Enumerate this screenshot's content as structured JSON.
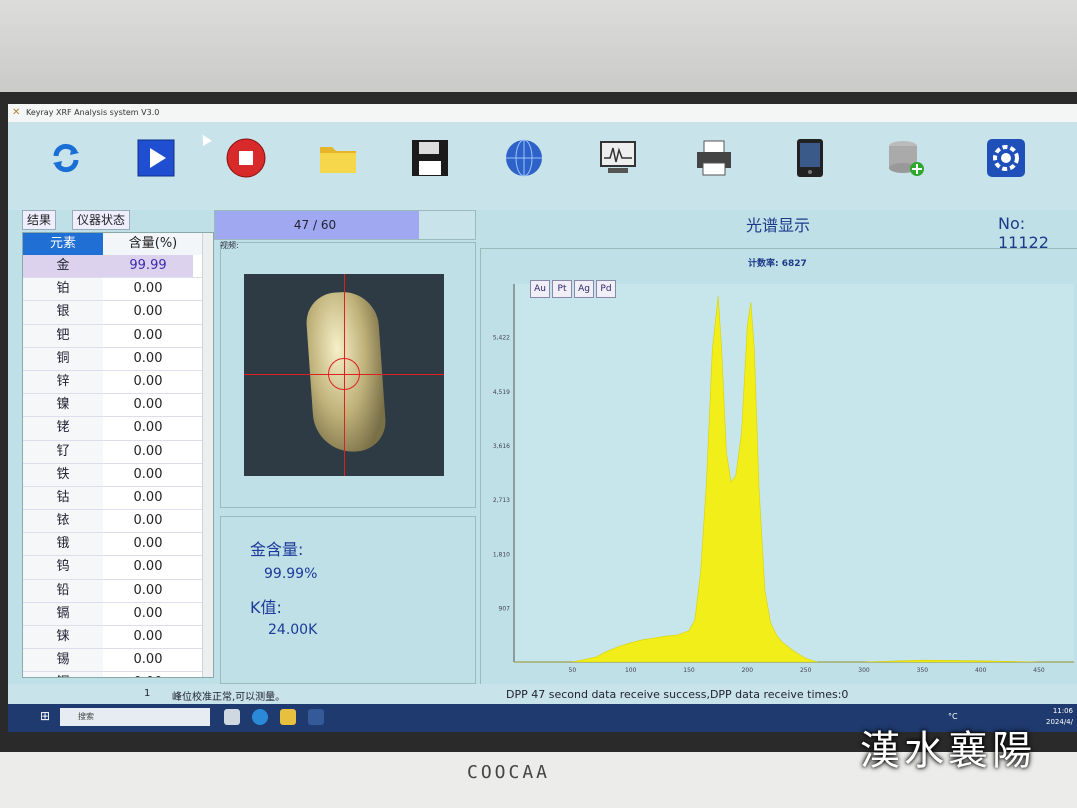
{
  "window": {
    "title": "Keyray XRF Analysis system V3.0"
  },
  "toolbar": {
    "buttons": [
      {
        "name": "refresh",
        "icon": "refresh-icon"
      },
      {
        "name": "start",
        "icon": "play-icon"
      },
      {
        "name": "stop",
        "icon": "stop-icon"
      },
      {
        "name": "open",
        "icon": "folder-icon"
      },
      {
        "name": "save",
        "icon": "floppy-disk-icon"
      },
      {
        "name": "network",
        "icon": "globe-icon"
      },
      {
        "name": "monitor",
        "icon": "monitor-spectrum-icon"
      },
      {
        "name": "print",
        "icon": "printer-icon"
      },
      {
        "name": "device",
        "icon": "device-icon"
      },
      {
        "name": "database",
        "icon": "database-add-icon"
      },
      {
        "name": "settings",
        "icon": "gear-icon"
      }
    ]
  },
  "tabs": {
    "results": "结果",
    "instrument_status": "仪器状态"
  },
  "table": {
    "headers": {
      "element": "元素",
      "content": "含量(%)"
    },
    "rows": [
      {
        "element": "金",
        "value": "99.99",
        "selected": true
      },
      {
        "element": "铂",
        "value": "0.00"
      },
      {
        "element": "银",
        "value": "0.00"
      },
      {
        "element": "钯",
        "value": "0.00"
      },
      {
        "element": "铜",
        "value": "0.00"
      },
      {
        "element": "锌",
        "value": "0.00"
      },
      {
        "element": "镍",
        "value": "0.00"
      },
      {
        "element": "铑",
        "value": "0.00"
      },
      {
        "element": "钌",
        "value": "0.00"
      },
      {
        "element": "铁",
        "value": "0.00"
      },
      {
        "element": "钴",
        "value": "0.00"
      },
      {
        "element": "铱",
        "value": "0.00"
      },
      {
        "element": "锇",
        "value": "0.00"
      },
      {
        "element": "钨",
        "value": "0.00"
      },
      {
        "element": "铅",
        "value": "0.00"
      },
      {
        "element": "镉",
        "value": "0.00"
      },
      {
        "element": "铼",
        "value": "0.00"
      },
      {
        "element": "锡",
        "value": "0.00"
      },
      {
        "element": "铟",
        "value": "0.00"
      }
    ]
  },
  "progress": {
    "text": "47 / 60",
    "fraction": 0.783
  },
  "video": {
    "label": "视频:"
  },
  "results": {
    "gold_label": "金含量:",
    "gold_value": "99.99%",
    "k_label": "K值:",
    "k_value": "24.00K"
  },
  "spectrum": {
    "title": "光谱显示",
    "number": "No: 11122",
    "count_rate": "计数率:  6827",
    "element_buttons": [
      "Au",
      "Pt",
      "Ag",
      "Pd"
    ]
  },
  "chart_data": {
    "type": "area",
    "color": "#f2ee1a",
    "y_ticks": [
      "907",
      "1,810",
      "2,713",
      "3,616",
      "4,519",
      "5,422"
    ],
    "y_tick_values": [
      907,
      1810,
      2713,
      3616,
      4519,
      5422
    ],
    "x_ticks": [
      "50",
      "100",
      "150",
      "200",
      "250",
      "300",
      "350",
      "400",
      "450"
    ],
    "x_tick_values": [
      50,
      100,
      150,
      200,
      250,
      300,
      350,
      400,
      450
    ],
    "xlim": [
      0,
      480
    ],
    "ylim": [
      0,
      6300
    ],
    "x": [
      0,
      50,
      70,
      80,
      90,
      100,
      110,
      120,
      130,
      140,
      150,
      155,
      160,
      165,
      170,
      175,
      178,
      182,
      186,
      190,
      195,
      200,
      203,
      206,
      210,
      215,
      220,
      225,
      230,
      240,
      250,
      260,
      280,
      300,
      350,
      400,
      450,
      480
    ],
    "y": [
      0,
      0,
      80,
      180,
      260,
      320,
      370,
      400,
      430,
      450,
      520,
      700,
      1500,
      3000,
      5200,
      6100,
      5200,
      3500,
      3000,
      3100,
      3800,
      5600,
      6000,
      5200,
      2900,
      1200,
      650,
      450,
      330,
      180,
      60,
      0,
      0,
      0,
      30,
      20,
      0,
      0
    ]
  },
  "status": {
    "index": "1",
    "message": "峰位校准正常,可以测量。",
    "dpp": "DPP 47 second data receive success,DPP data receive times:0"
  },
  "taskbar": {
    "search_placeholder": "搜索",
    "temperature": "°C",
    "time": "11:06",
    "date": "2024/4/",
    "lang": "英"
  },
  "monitor": {
    "brand": "COOCAA"
  },
  "watermark": "漢水襄陽"
}
